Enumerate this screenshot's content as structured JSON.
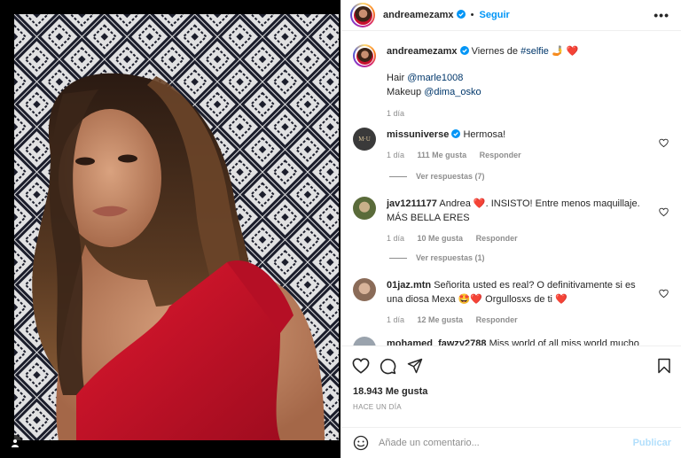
{
  "post": {
    "username": "andreamezamx",
    "follow_label": "Seguir",
    "separator": "•",
    "caption_text": "Viernes de ",
    "caption_tag": "#selfie",
    "caption_emojis": "🤳 ❤️",
    "credits": [
      {
        "label": "Hair ",
        "handle": "@marle1008"
      },
      {
        "label": "Makeup ",
        "handle": "@dima_osko"
      }
    ],
    "caption_time": "1 día"
  },
  "comments": [
    {
      "user": "missuniverse",
      "verified": true,
      "text": "Hermosa!",
      "time": "1 día",
      "likes": "111 Me gusta",
      "reply": "Responder",
      "view_replies": "Ver respuestas (7)"
    },
    {
      "user": "jav1211177",
      "text_a": "Andrea ",
      "emoji_a": "❤️",
      "text_b": ". INSISTO! Entre menos maquillaje. MÁS BELLA ERES",
      "time": "1 día",
      "likes": "10 Me gusta",
      "reply": "Responder",
      "view_replies": "Ver respuestas (1)"
    },
    {
      "user": "01jaz.mtn",
      "text_a": "Señorita usted es real? O definitivamente si es una diosa Mexa ",
      "emoji_a": "🤩❤️",
      "text_b": " Orgullosxs de ti ",
      "emoji_b": "❤️",
      "time": "1 día",
      "likes": "12 Me gusta",
      "reply": "Responder"
    },
    {
      "user": "mohamed_fawzy2788",
      "text": "Miss world of all miss world mucho"
    }
  ],
  "footer": {
    "likes": "18.943 Me gusta",
    "ago": "HACE UN DÍA",
    "comment_placeholder": "Añade un comentario...",
    "post_label": "Publicar"
  },
  "icons": {
    "header_more": "more-icon",
    "like": "heart-icon",
    "comment": "comment-icon",
    "share": "share-icon",
    "save": "bookmark-icon",
    "emoji": "smiley-icon",
    "tagged": "user-tag-icon"
  },
  "colors": {
    "link": "#00376b",
    "follow": "#0095f6",
    "muted": "#8e8e8e",
    "dress": "#c8102e"
  }
}
